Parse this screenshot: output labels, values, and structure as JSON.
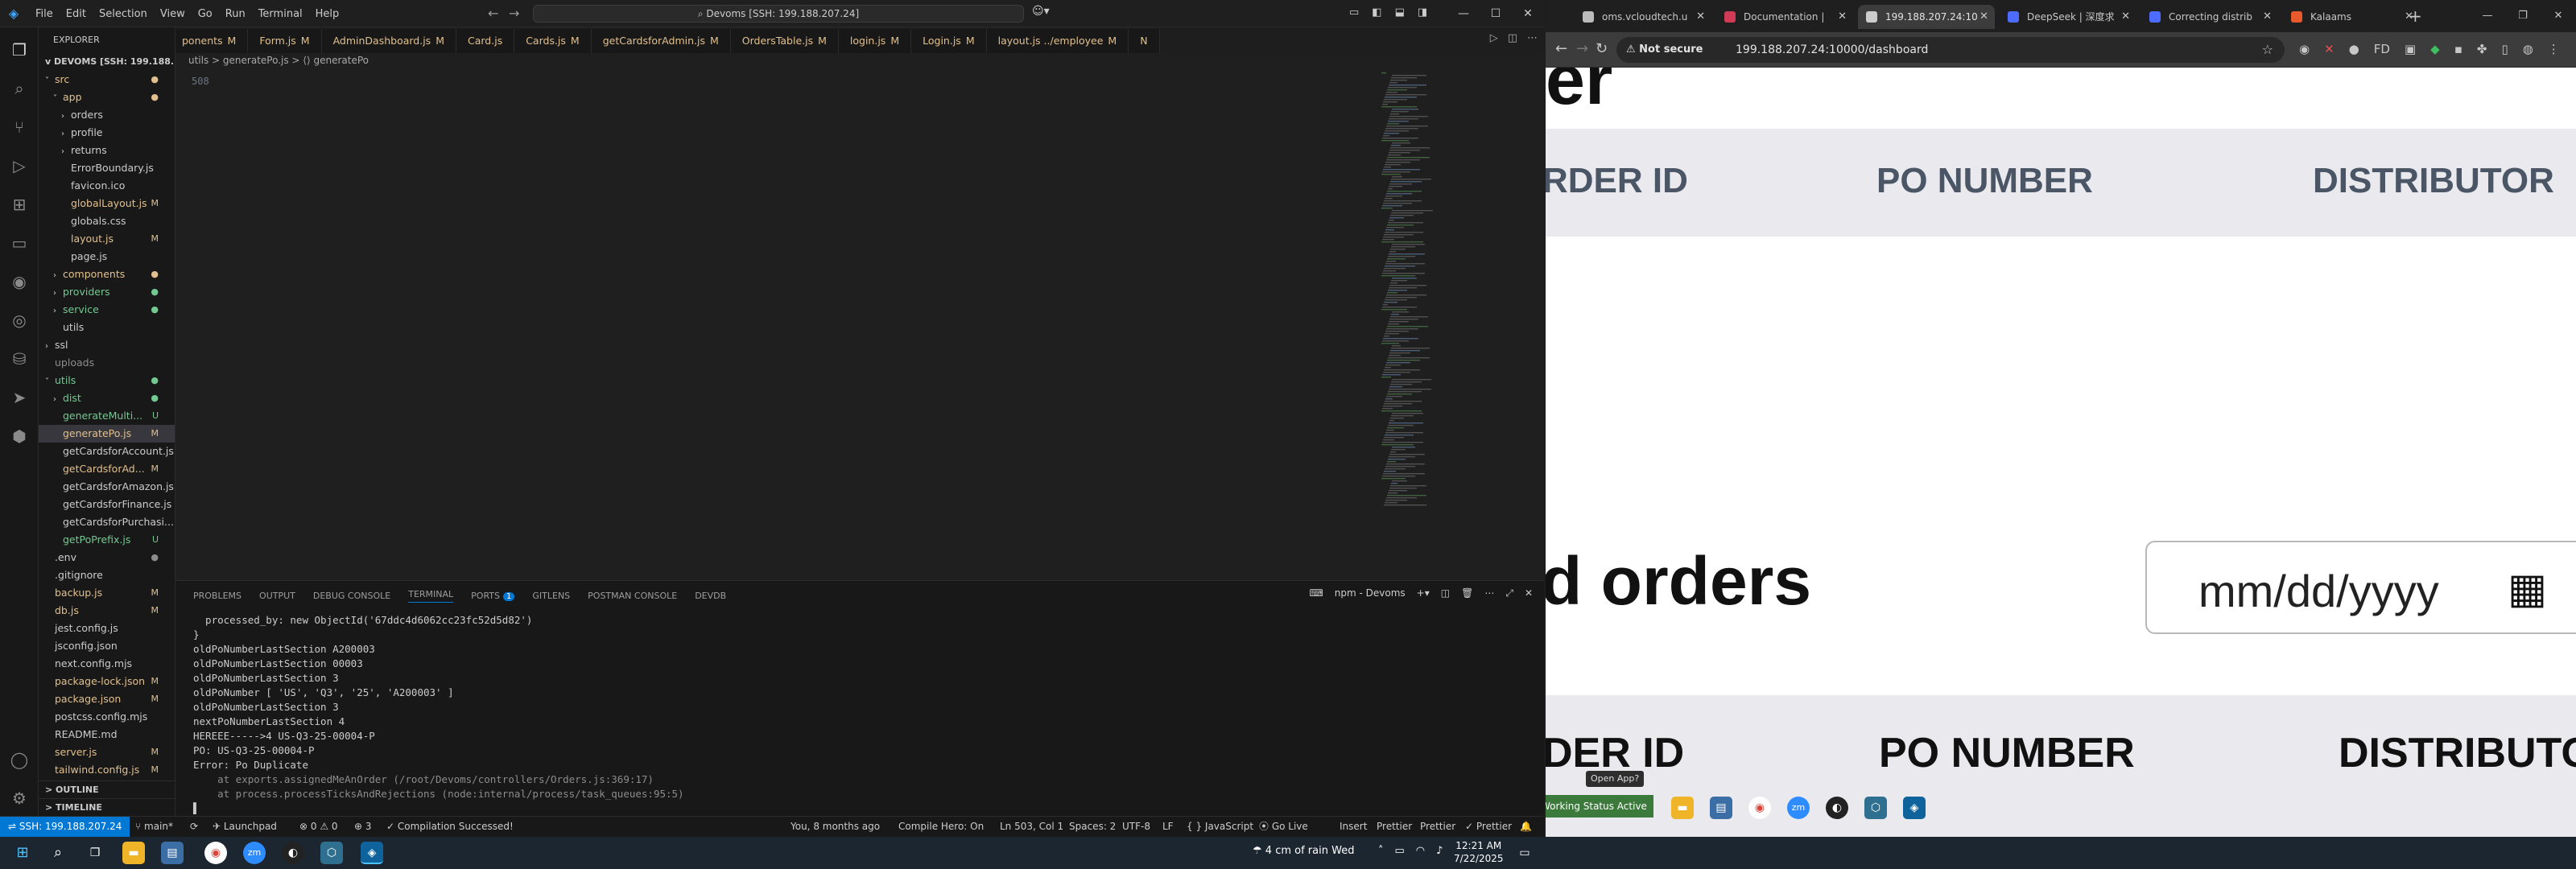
{
  "vscode": {
    "menu": [
      "File",
      "Edit",
      "Selection",
      "View",
      "Go",
      "Run",
      "Terminal",
      "Help"
    ],
    "search": "Devoms [SSH: 199.188.207.24]",
    "tabs": [
      {
        "label": "ponents",
        "mod": "M"
      },
      {
        "label": "Form.js",
        "mod": "M"
      },
      {
        "label": "AdminDashboard.js",
        "mod": "M"
      },
      {
        "label": "Card.js",
        "mod": ""
      },
      {
        "label": "Cards.js",
        "mod": "M"
      },
      {
        "label": "getCardsforAdmin.js",
        "mod": "M"
      },
      {
        "label": "OrdersTable.js",
        "mod": "M"
      },
      {
        "label": "login.js",
        "mod": "M"
      },
      {
        "label": "Login.js",
        "mod": "M"
      },
      {
        "label": "layout.js ../employee",
        "mod": "M"
      },
      {
        "label": "N",
        "mod": ""
      }
    ],
    "explorer_title": "EXPLORER",
    "root_label": "DEVOMS [SSH: 199.188.20...",
    "tree": [
      {
        "indent": 1,
        "chev": "v",
        "label": "src",
        "cls": "c-mod",
        "badge": "●",
        "bcls": "c-mod"
      },
      {
        "indent": 2,
        "chev": "v",
        "label": "app",
        "cls": "c-mod",
        "badge": "●",
        "bcls": "c-mod"
      },
      {
        "indent": 3,
        "chev": ">",
        "label": "orders",
        "cls": "",
        "badge": "",
        "bcls": ""
      },
      {
        "indent": 3,
        "chev": ">",
        "label": "profile",
        "cls": "",
        "badge": "",
        "bcls": ""
      },
      {
        "indent": 3,
        "chev": ">",
        "label": "returns",
        "cls": "",
        "badge": "",
        "bcls": ""
      },
      {
        "indent": 3,
        "chev": "",
        "label": "ErrorBoundary.js",
        "cls": "",
        "badge": "",
        "bcls": ""
      },
      {
        "indent": 3,
        "chev": "",
        "label": "favicon.ico",
        "cls": "",
        "badge": "",
        "bcls": ""
      },
      {
        "indent": 3,
        "chev": "",
        "label": "globalLayout.js",
        "cls": "c-mod",
        "badge": "M",
        "bcls": "c-mod"
      },
      {
        "indent": 3,
        "chev": "",
        "label": "globals.css",
        "cls": "",
        "badge": "",
        "bcls": ""
      },
      {
        "indent": 3,
        "chev": "",
        "label": "layout.js",
        "cls": "c-mod",
        "badge": "M",
        "bcls": "c-mod"
      },
      {
        "indent": 3,
        "chev": "",
        "label": "page.js",
        "cls": "",
        "badge": "",
        "bcls": ""
      },
      {
        "indent": 2,
        "chev": ">",
        "label": "components",
        "cls": "c-mod",
        "badge": "●",
        "bcls": "c-mod"
      },
      {
        "indent": 2,
        "chev": ">",
        "label": "providers",
        "cls": "c-untr",
        "badge": "●",
        "bcls": "c-untr"
      },
      {
        "indent": 2,
        "chev": ">",
        "label": "service",
        "cls": "c-untr",
        "badge": "●",
        "bcls": "c-untr"
      },
      {
        "indent": 2,
        "chev": "",
        "label": "utils",
        "cls": "",
        "badge": "",
        "bcls": ""
      },
      {
        "indent": 1,
        "chev": ">",
        "label": "ssl",
        "cls": "",
        "badge": "",
        "bcls": ""
      },
      {
        "indent": 1,
        "chev": "",
        "label": "uploads",
        "cls": "c-dim",
        "badge": "",
        "bcls": ""
      },
      {
        "indent": 1,
        "chev": "v",
        "label": "utils",
        "cls": "c-untr",
        "badge": "●",
        "bcls": "c-untr"
      },
      {
        "indent": 2,
        "chev": ">",
        "label": "dist",
        "cls": "c-untr",
        "badge": "●",
        "bcls": "c-untr"
      },
      {
        "indent": 2,
        "chev": "",
        "label": "generateMulti...",
        "cls": "c-untr",
        "badge": "U",
        "bcls": "c-untr"
      },
      {
        "indent": 2,
        "chev": "",
        "label": "generatePo.js",
        "cls": "c-mod",
        "badge": "M",
        "bcls": "c-mod",
        "sel": true
      },
      {
        "indent": 2,
        "chev": "",
        "label": "getCardsforAccount.js",
        "cls": "",
        "badge": "",
        "bcls": ""
      },
      {
        "indent": 2,
        "chev": "",
        "label": "getCardsforAd...",
        "cls": "c-mod",
        "badge": "M",
        "bcls": "c-mod"
      },
      {
        "indent": 2,
        "chev": "",
        "label": "getCardsforAmazon.js",
        "cls": "",
        "badge": "",
        "bcls": ""
      },
      {
        "indent": 2,
        "chev": "",
        "label": "getCardsforFinance.js",
        "cls": "",
        "badge": "",
        "bcls": ""
      },
      {
        "indent": 2,
        "chev": "",
        "label": "getCardsforPurchasi...",
        "cls": "",
        "badge": "",
        "bcls": ""
      },
      {
        "indent": 2,
        "chev": "",
        "label": "getPoPrefix.js",
        "cls": "c-untr",
        "badge": "U",
        "bcls": "c-untr"
      },
      {
        "indent": 1,
        "chev": "",
        "label": ".env",
        "cls": "",
        "badge": "●",
        "bcls": "c-dim"
      },
      {
        "indent": 1,
        "chev": "",
        "label": ".gitignore",
        "cls": "",
        "badge": "",
        "bcls": ""
      },
      {
        "indent": 1,
        "chev": "",
        "label": "backup.js",
        "cls": "c-mod",
        "badge": "M",
        "bcls": "c-mod"
      },
      {
        "indent": 1,
        "chev": "",
        "label": "db.js",
        "cls": "c-mod",
        "badge": "M",
        "bcls": "c-mod"
      },
      {
        "indent": 1,
        "chev": "",
        "label": "jest.config.js",
        "cls": "",
        "badge": "",
        "bcls": ""
      },
      {
        "indent": 1,
        "chev": "",
        "label": "jsconfig.json",
        "cls": "",
        "badge": "",
        "bcls": ""
      },
      {
        "indent": 1,
        "chev": "",
        "label": "next.config.mjs",
        "cls": "",
        "badge": "",
        "bcls": ""
      },
      {
        "indent": 1,
        "chev": "",
        "label": "package-lock.json",
        "cls": "c-mod",
        "badge": "M",
        "bcls": "c-mod"
      },
      {
        "indent": 1,
        "chev": "",
        "label": "package.json",
        "cls": "c-mod",
        "badge": "M",
        "bcls": "c-mod"
      },
      {
        "indent": 1,
        "chev": "",
        "label": "postcss.config.mjs",
        "cls": "",
        "badge": "",
        "bcls": ""
      },
      {
        "indent": 1,
        "chev": "",
        "label": "README.md",
        "cls": "",
        "badge": "",
        "bcls": ""
      },
      {
        "indent": 1,
        "chev": "",
        "label": "server.js",
        "cls": "c-mod",
        "badge": "M",
        "bcls": "c-mod"
      },
      {
        "indent": 1,
        "chev": "",
        "label": "tailwind.config.js",
        "cls": "c-mod",
        "badge": "M",
        "bcls": "c-mod"
      }
    ],
    "outline_label": "OUTLINE",
    "timeline_label": "TIMELINE",
    "breadcrumb": "utils > generatePo.js > ⟨⟩ generatePo",
    "line_number": "508",
    "panel_tabs": [
      "PROBLEMS",
      "OUTPUT",
      "DEBUG CONSOLE",
      "TERMINAL",
      "PORTS",
      "GITLENS",
      "POSTMAN CONSOLE",
      "DEVDB"
    ],
    "ports_badge": "1",
    "terminal_name": "npm - Devoms",
    "terminal_lines": [
      "  processed_by: new ObjectId('67ddc4d6062cc23fc52d5d82')",
      "}",
      "oldPoNumberLastSection A200003",
      "oldPoNumberLastSection 00003",
      "oldPoNumberLastSection 3",
      "oldPoNumber [ 'US', 'Q3', '25', 'A200003' ]",
      "oldPoNumberLastSection 3",
      "nextPoNumberLastSection 4",
      "HEREEE----->4 US-Q3-25-00004-P",
      "PO: US-Q3-25-00004-P",
      "Error: Po Duplicate",
      "    at exports.assignedMeAnOrder (/root/Devoms/controllers/Orders.js:369:17)",
      "    at process.processTicksAndRejections (node:internal/process/task_queues:95:5)"
    ],
    "status": {
      "remote": "SSH: 199.188.207.24",
      "branch": "main*",
      "sync": "⟳",
      "launchpad": "Launchpad",
      "problems": "⊗ 0 ⚠ 0",
      "ports": "⊕ 3",
      "compilation": "✓ Compilation Successed!",
      "blame": "You, 8 months ago",
      "compile_hero": "Compile Hero: On",
      "position": "Ln 503, Col 1",
      "spaces": "Spaces: 2",
      "encoding": "UTF-8",
      "eol": "LF",
      "language": "{ } JavaScript",
      "golive": "Go Live",
      "insert": "Insert",
      "prettier1": "Prettier",
      "prettier2": "Prettier",
      "prettier3": "✓ Prettier"
    }
  },
  "chrome": {
    "tabs": [
      {
        "label": "oms.vcloudtech.u",
        "fav": "#bbbbbb",
        "active": false
      },
      {
        "label": "Documentation |",
        "fav": "#d23b55",
        "active": false
      },
      {
        "label": "199.188.207.24:10",
        "fav": "#cccccc",
        "active": true
      },
      {
        "label": "DeepSeek | 深度求",
        "fav": "#4d6bfe",
        "active": false
      },
      {
        "label": "Correcting distrib",
        "fav": "#4d6bfe",
        "active": false
      },
      {
        "label": "Kalaams",
        "fav": "#e85a2b",
        "active": false
      }
    ],
    "not_secure": "⚠ Not secure",
    "url": "199.188.207.24:10000/dashboard",
    "page": {
      "top_fragment": "er",
      "headers_top": [
        "RDER ID",
        "PO NUMBER",
        "DISTRIBUTOR"
      ],
      "title": "d orders",
      "date_placeholder": "mm/dd/yyyy",
      "headers_bottom": [
        "DER ID",
        "PO NUMBER",
        "DISTRIBUTO"
      ]
    },
    "overlay_tooltip": "Open App?",
    "working_status": "Working Status Active"
  },
  "taskbar": {
    "weather": "4 cm of rain Wed",
    "time": "12:21 AM",
    "date": "7/22/2025"
  }
}
